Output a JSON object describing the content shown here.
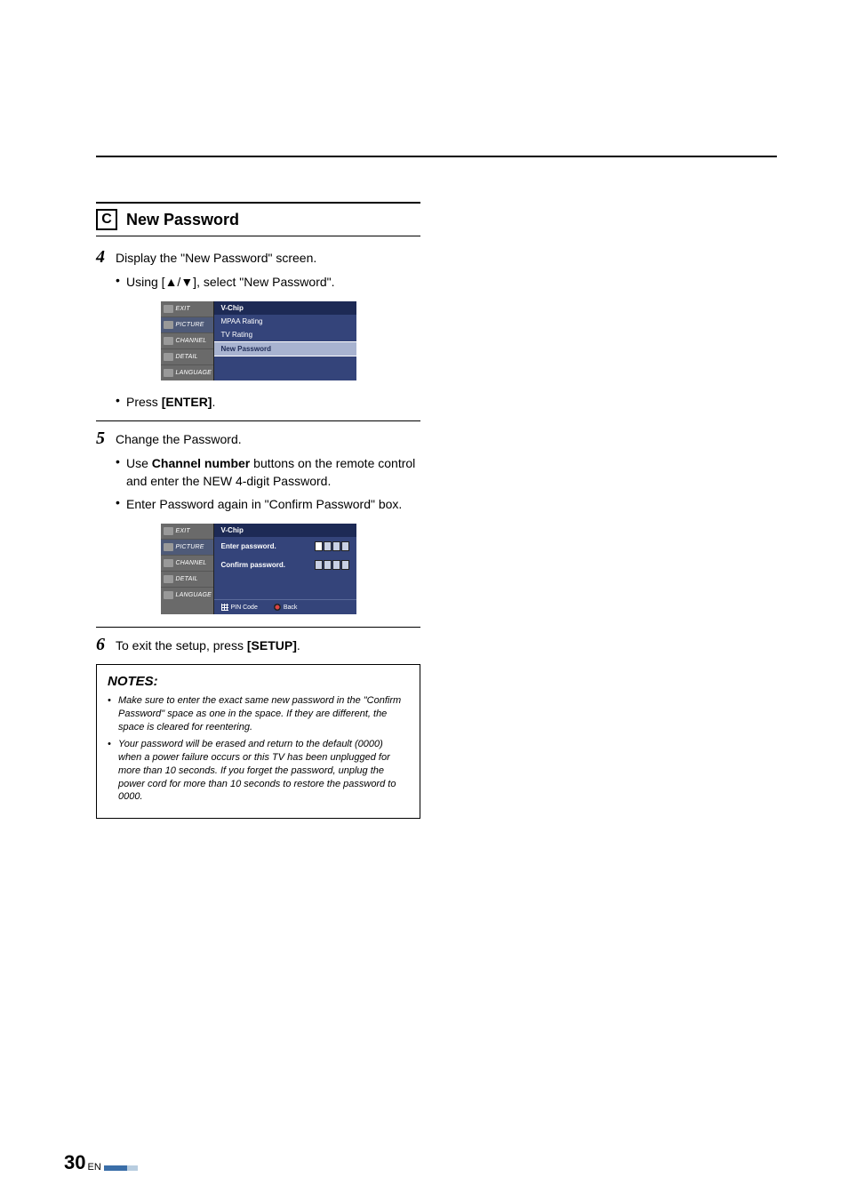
{
  "section": {
    "letter": "C",
    "title": "New Password"
  },
  "step4": {
    "num": "4",
    "text": "Display the \"New Password\" screen.",
    "bullet1": "Using [▲/▼], select \"New Password\".",
    "bullet2a": "Press ",
    "bullet2b": "[ENTER]",
    "bullet2c": "."
  },
  "step5": {
    "num": "5",
    "text": "Change the Password.",
    "bullet1a": "Use ",
    "bullet1b": "Channel number",
    "bullet1c": " buttons on the remote control and enter the NEW 4-digit Password.",
    "bullet2": "Enter Password again in \"Confirm Password\" box."
  },
  "step6": {
    "num": "6",
    "text1": "To exit the setup, press ",
    "text2": "[SETUP]",
    "text3": "."
  },
  "osd": {
    "nav": {
      "exit": "EXIT",
      "picture": "PICTURE",
      "channel": "CHANNEL",
      "detail": "DETAIL",
      "language": "LANGUAGE"
    },
    "title": "V-Chip",
    "screen1": {
      "row1": "MPAA Rating",
      "row2": "TV Rating",
      "row3": "New Password"
    },
    "screen2": {
      "row1": "Enter password.",
      "row2": "Confirm password.",
      "footer1": "PIN Code",
      "footer2": "Back"
    }
  },
  "notes": {
    "title": "NOTES:",
    "n1": "Make sure to enter the exact same new password in the \"Confirm Password\" space as one in the space. If they are different, the space is cleared for reentering.",
    "n2": "Your password will be erased and return to the default (0000) when a power failure occurs or this TV has been unplugged for more than 10 seconds. If you forget the password, unplug the power cord for more than 10 seconds to restore the password to 0000."
  },
  "page": {
    "num": "30",
    "lang": "EN"
  }
}
